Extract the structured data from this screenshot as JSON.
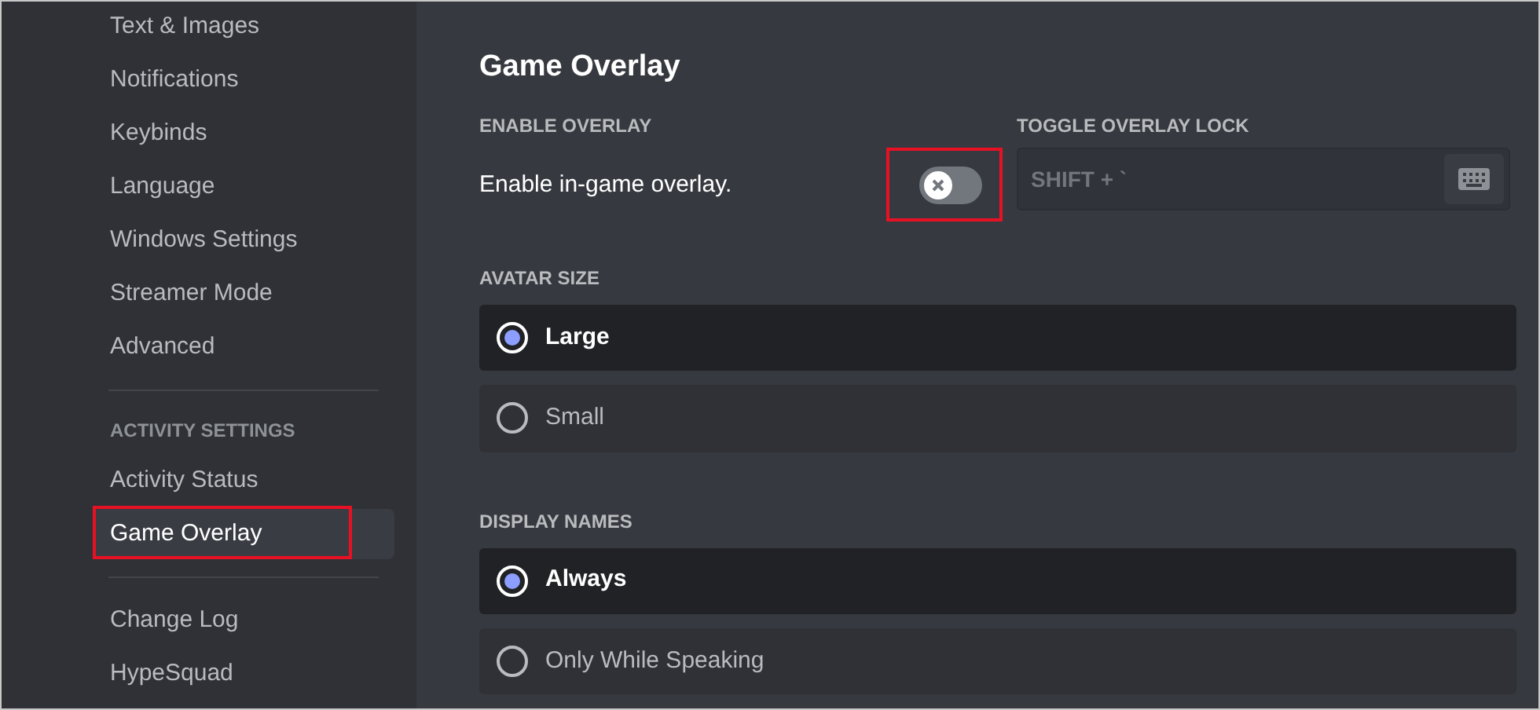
{
  "sidebar": {
    "sections": [
      {
        "items": [
          {
            "label": "Text & Images",
            "selected": false,
            "annotated": false
          },
          {
            "label": "Notifications",
            "selected": false,
            "annotated": false
          },
          {
            "label": "Keybinds",
            "selected": false,
            "annotated": false
          },
          {
            "label": "Language",
            "selected": false,
            "annotated": false
          },
          {
            "label": "Windows Settings",
            "selected": false,
            "annotated": false
          },
          {
            "label": "Streamer Mode",
            "selected": false,
            "annotated": false
          },
          {
            "label": "Advanced",
            "selected": false,
            "annotated": false
          }
        ]
      },
      {
        "header": "ACTIVITY SETTINGS",
        "items": [
          {
            "label": "Activity Status",
            "selected": false,
            "annotated": false
          },
          {
            "label": "Game Overlay",
            "selected": true,
            "annotated": true
          }
        ]
      },
      {
        "items": [
          {
            "label": "Change Log",
            "selected": false,
            "annotated": false
          },
          {
            "label": "HypeSquad",
            "selected": false,
            "annotated": false
          }
        ]
      }
    ]
  },
  "main": {
    "title": "Game Overlay",
    "enable_overlay": {
      "header": "ENABLE OVERLAY",
      "label": "Enable in-game overlay.",
      "on": false,
      "annotated": true
    },
    "toggle_lock": {
      "header": "TOGGLE OVERLAY LOCK",
      "value": "SHIFT + `"
    },
    "groups": [
      {
        "header": "AVATAR SIZE",
        "options": [
          {
            "label": "Large",
            "selected": true
          },
          {
            "label": "Small",
            "selected": false
          }
        ]
      },
      {
        "header": "DISPLAY NAMES",
        "options": [
          {
            "label": "Always",
            "selected": true
          },
          {
            "label": "Only While Speaking",
            "selected": false
          }
        ]
      }
    ]
  }
}
